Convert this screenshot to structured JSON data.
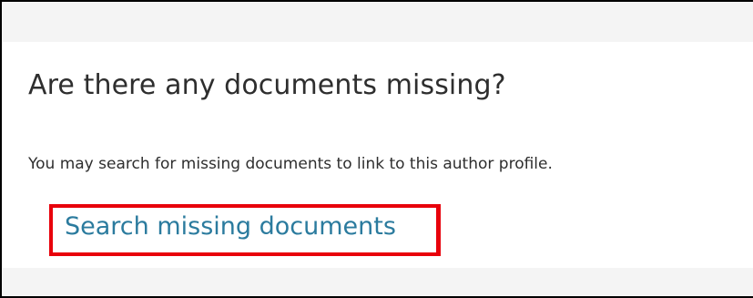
{
  "section": {
    "heading": "Are there any documents missing?",
    "description": "You may search for missing documents to link to this author profile.",
    "search_link_label": "Search missing documents"
  },
  "colors": {
    "link": "#2b7b9e",
    "highlight_border": "#e8000b",
    "band_background": "#f4f4f4",
    "text": "#2e2e2e"
  }
}
